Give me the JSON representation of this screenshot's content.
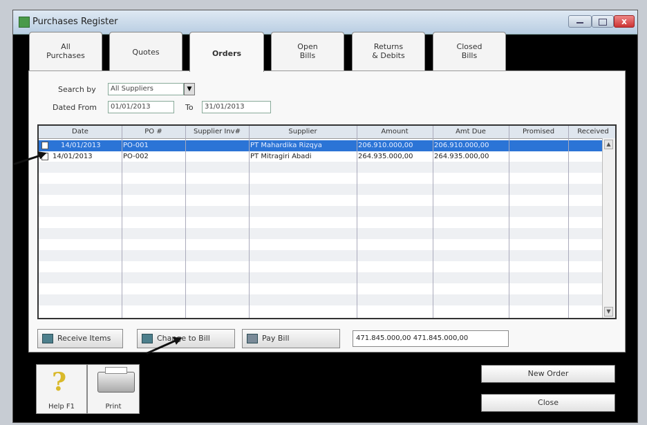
{
  "window": {
    "title": "Purchases Register",
    "close_glyph": "x"
  },
  "tabs": [
    {
      "line1": "All",
      "line2": "Purchases",
      "active": false
    },
    {
      "line1": "Quotes",
      "line2": "",
      "active": false
    },
    {
      "line1": "Orders",
      "line2": "",
      "active": true
    },
    {
      "line1": "Open",
      "line2": "Bills",
      "active": false
    },
    {
      "line1": "Returns",
      "line2": "& Debits",
      "active": false
    },
    {
      "line1": "Closed",
      "line2": "Bills",
      "active": false
    }
  ],
  "search": {
    "search_by_label": "Search by",
    "search_by_value": "All Suppliers",
    "dated_from_label": "Dated From",
    "dated_from_value": "01/01/2013",
    "to_label": "To",
    "to_value": "31/01/2013",
    "dropdown_glyph": "▼"
  },
  "table": {
    "columns": [
      "Date",
      "PO #",
      "Supplier Inv#",
      "Supplier",
      "Amount",
      "Amt Due",
      "Promised",
      "Received"
    ],
    "rows": [
      {
        "date": "14/01/2013",
        "po": "PO-001",
        "supplier_inv": "",
        "supplier": "PT Mahardika Rizqya",
        "amount": "206.910.000,00",
        "amt_due": "206.910.000,00",
        "promised": "",
        "received": "",
        "selected": true
      },
      {
        "date": "14/01/2013",
        "po": "PO-002",
        "supplier_inv": "",
        "supplier": "PT Mitragiri Abadi",
        "amount": "264.935.000,00",
        "amt_due": "264.935.000,00",
        "promised": "",
        "received": "",
        "selected": false
      }
    ],
    "scroll_up": "▲",
    "scroll_down": "▼"
  },
  "actions": {
    "receive_items": "Receive Items",
    "change_to_bill": "Change to Bill",
    "pay_bill": "Pay Bill",
    "total_amount": "471.845.000,00",
    "total_amt_due": "471.845.000,00",
    "new_order": "New Order",
    "close": "Close",
    "help": "Help F1",
    "print": "Print",
    "help_glyph": "?"
  },
  "colors": {
    "selection": "#2b74d6",
    "window_bg": "#f8f8f8",
    "frame": "#000000"
  },
  "icons": [
    "window-icon",
    "row-doc-icon",
    "receive-items-icon",
    "change-to-bill-icon",
    "pay-bill-icon",
    "help-icon",
    "printer-icon"
  ]
}
